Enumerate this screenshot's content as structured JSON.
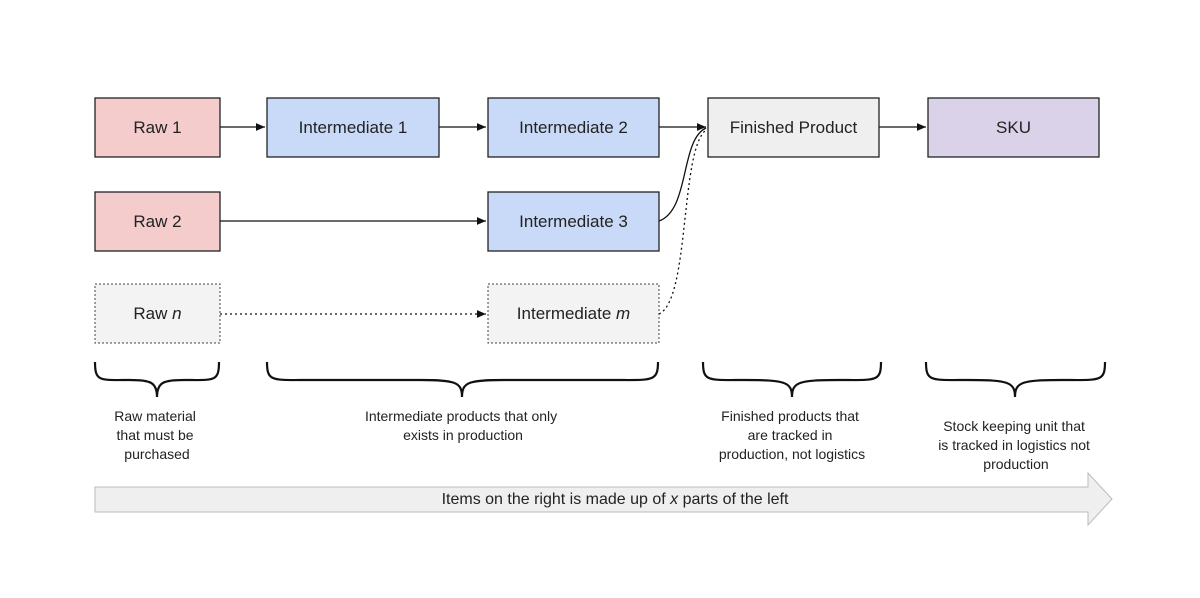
{
  "colors": {
    "raw": "#f4cccc",
    "intermediate": "#c9daf8",
    "finished": "#efefef",
    "sku": "#d9d2e9",
    "placeholder": "#f3f3f3",
    "arrow": "#efefef"
  },
  "nodes": {
    "raw1": {
      "label": "Raw 1"
    },
    "raw2": {
      "label": "Raw 2"
    },
    "rawn": {
      "label": "Raw ",
      "var": "n"
    },
    "int1": {
      "label": "Intermediate 1"
    },
    "int2": {
      "label": "Intermediate 2"
    },
    "int3": {
      "label": "Intermediate 3"
    },
    "intm": {
      "label": "Intermediate ",
      "var": "m"
    },
    "finished": {
      "label": "Finished Product"
    },
    "sku": {
      "label": "SKU"
    }
  },
  "captions": {
    "raw": [
      "Raw material",
      "that must be",
      "purchased"
    ],
    "intermediate": [
      "Intermediate products that only",
      "exists in production"
    ],
    "finished": [
      "Finished products that",
      "are tracked in",
      "production, not logistics"
    ],
    "sku": [
      "Stock keeping unit that",
      "is tracked in logistics not",
      "production"
    ]
  },
  "flow_arrow": {
    "before": "Items on the right is made up of ",
    "var": "x",
    "after": " parts of the left"
  }
}
